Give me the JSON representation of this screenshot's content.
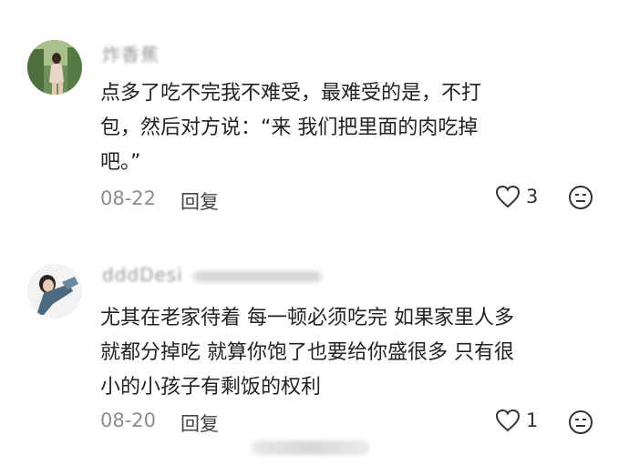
{
  "comments": [
    {
      "username": "炸香蕉",
      "lines": [
        "点多了吃不完我不难受，最难受的是，不打",
        "包，然后对方说：“来 我们把里面的肉吃掉",
        "吧。”"
      ],
      "date": "08-22",
      "reply_label": "回复",
      "likes": "3",
      "avatar_icon": "user-avatar-photo",
      "like_icon": "heart-outline-icon",
      "emoji_icon": "emoji-face-icon"
    },
    {
      "username": "dddDesi",
      "lines": [
        "尤其在老家待着 每一顿必须吃完 如果家里人多",
        "就都分掉吃 就算你饱了也要给你盛很多 只有很",
        "小的小孩子有剩饭的权利"
      ],
      "date": "08-20",
      "reply_label": "回复",
      "likes": "1",
      "avatar_icon": "user-avatar-photo",
      "like_icon": "heart-outline-icon",
      "emoji_icon": "emoji-face-icon"
    }
  ],
  "colors": {
    "text": "#222222",
    "meta": "#8c8c8c",
    "reply": "#444444"
  }
}
